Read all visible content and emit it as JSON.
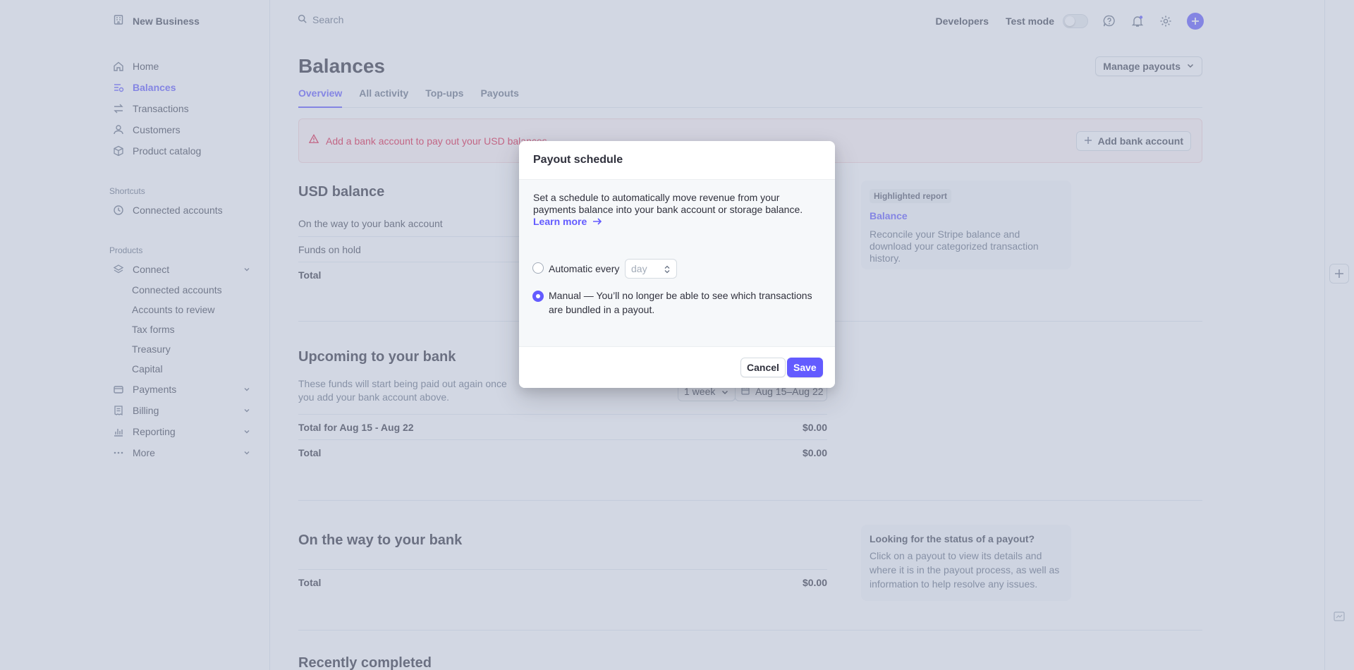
{
  "account": {
    "name": "New Business"
  },
  "sidebar": {
    "items": [
      {
        "label": "Home"
      },
      {
        "label": "Balances"
      },
      {
        "label": "Transactions"
      },
      {
        "label": "Customers"
      },
      {
        "label": "Product catalog"
      }
    ],
    "shortcuts_label": "Shortcuts",
    "shortcuts": [
      {
        "label": "Connected accounts"
      }
    ],
    "products_label": "Products",
    "connect": {
      "label": "Connect",
      "children": [
        {
          "label": "Connected accounts"
        },
        {
          "label": "Accounts to review"
        },
        {
          "label": "Tax forms"
        },
        {
          "label": "Treasury"
        },
        {
          "label": "Capital"
        }
      ]
    },
    "groups": [
      {
        "label": "Payments"
      },
      {
        "label": "Billing"
      },
      {
        "label": "Reporting"
      },
      {
        "label": "More"
      }
    ]
  },
  "topbar": {
    "search_placeholder": "Search",
    "developers": "Developers",
    "test_mode": "Test mode"
  },
  "page": {
    "title": "Balances",
    "manage_payouts": "Manage payouts",
    "tabs": [
      {
        "label": "Overview"
      },
      {
        "label": "All activity"
      },
      {
        "label": "Top-ups"
      },
      {
        "label": "Payouts"
      }
    ],
    "alert": {
      "text": "Add a bank account to pay out your USD balances.",
      "button": "Add bank account"
    },
    "usd_balance": {
      "title": "USD balance",
      "rows": [
        {
          "label": "On the way to your bank account"
        },
        {
          "label": "Funds on hold"
        },
        {
          "label": "Total"
        }
      ]
    },
    "highlighted_report": {
      "tag": "Highlighted report",
      "title": "Balance",
      "desc": "Reconcile your Stripe balance and download your categorized transaction history."
    },
    "upcoming": {
      "title": "Upcoming to your bank",
      "desc": "These funds will start being paid out again once you add your bank account above.",
      "period": "1 week",
      "range": "Aug 15–Aug 22",
      "total_for_label": "Total for Aug 15 - Aug 22",
      "total_for_value": "$0.00",
      "total_label": "Total",
      "total_value": "$0.00"
    },
    "on_the_way": {
      "title": "On the way to your bank",
      "total_label": "Total",
      "total_value": "$0.00",
      "help_title": "Looking for the status of a payout?",
      "help_desc": "Click on a payout to view its details and where it is in the payout process, as well as information to help resolve any issues."
    },
    "recently_completed": {
      "title": "Recently completed"
    }
  },
  "modal": {
    "title": "Payout schedule",
    "desc": "Set a schedule to automatically move revenue from your payments balance into your bank account or storage balance.",
    "learn_more": "Learn more",
    "automatic_label": "Automatic every",
    "interval_value": "day",
    "manual_label": "Manual — You’ll no longer be able to see which transactions are bundled in a payout.",
    "selected": "manual",
    "cancel": "Cancel",
    "save": "Save"
  },
  "colors": {
    "accent": "#635bff",
    "danger": "#df1b41"
  }
}
